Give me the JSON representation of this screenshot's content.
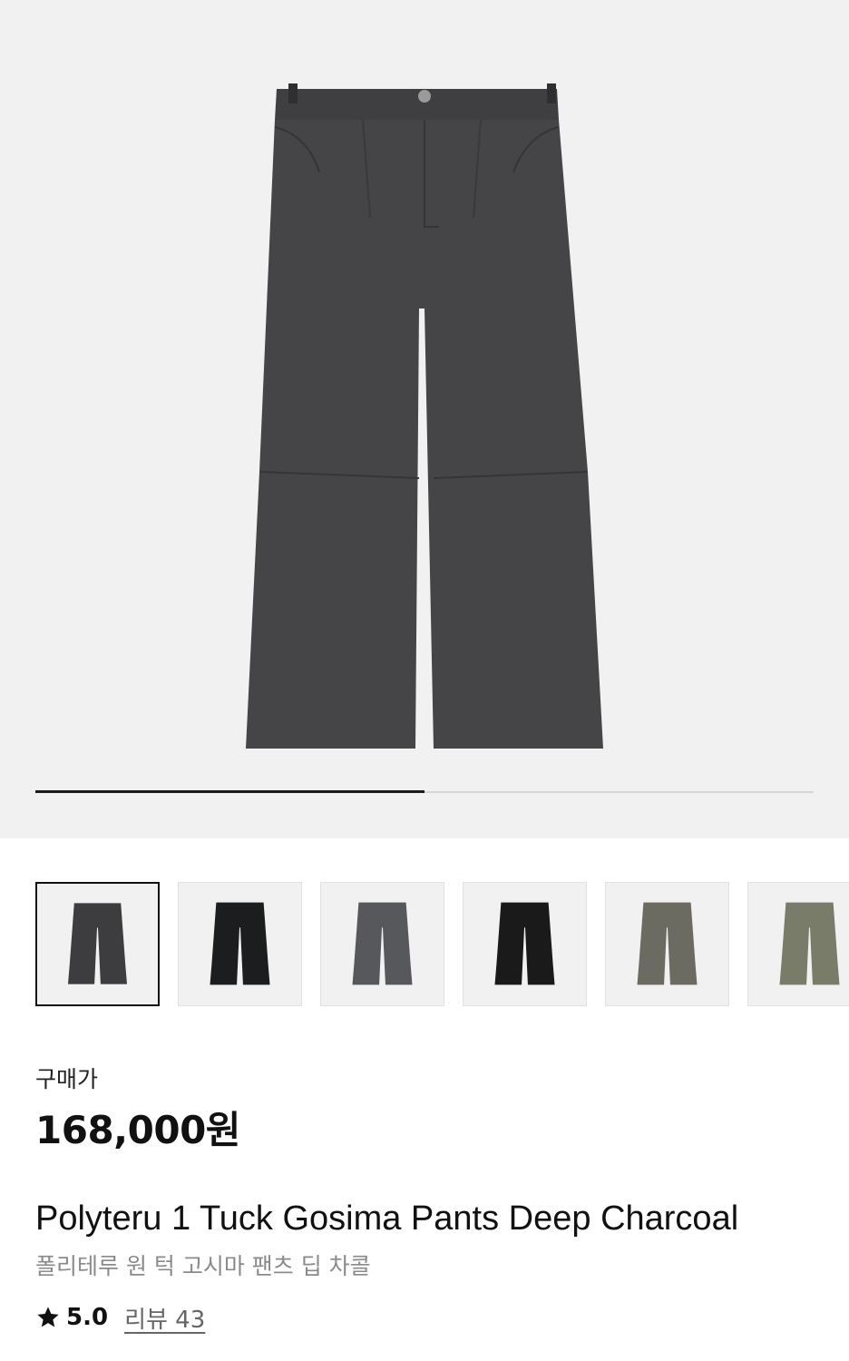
{
  "gallery": {
    "main_image": "product-photo-pants-deep-charcoal",
    "current_slide": 1,
    "total_slides": 2
  },
  "thumbnails": [
    {
      "name": "thumb-deep-charcoal",
      "color": "#3d3d3f",
      "selected": true
    },
    {
      "name": "thumb-black",
      "color": "#1c1d1e",
      "selected": false
    },
    {
      "name": "thumb-grey",
      "color": "#56585b",
      "selected": false
    },
    {
      "name": "thumb-washed-black",
      "color": "#1a1a1a",
      "selected": false
    },
    {
      "name": "thumb-olive-grey",
      "color": "#6b6b62",
      "selected": false
    },
    {
      "name": "thumb-olive",
      "color": "#7a7c6a",
      "selected": false
    }
  ],
  "product": {
    "price_label": "구매가",
    "price": "168,000원",
    "name_en": "Polyteru 1 Tuck Gosima Pants Deep Charcoal",
    "name_ko": "폴리테루 원 턱 고시마 팬츠 딥 차콜",
    "rating": "5.0",
    "review_label": "리뷰 43"
  },
  "colors": {
    "hero_bg": "#f1f1f1",
    "pants_main": "#454547"
  }
}
